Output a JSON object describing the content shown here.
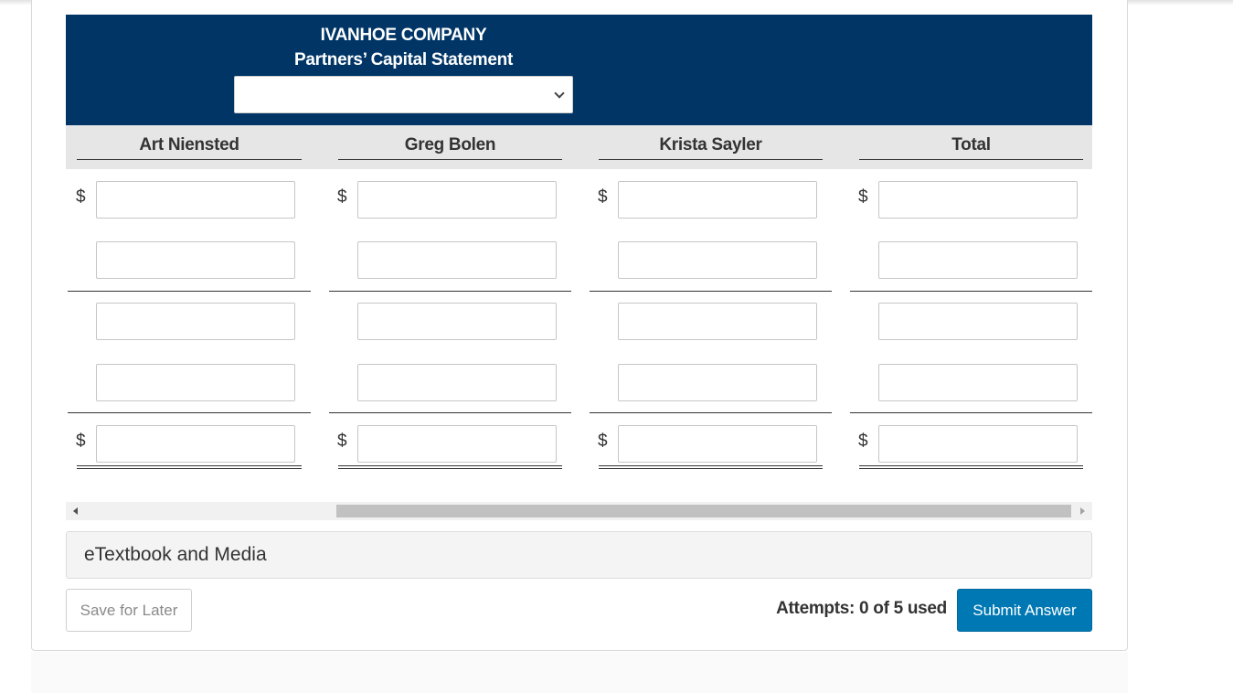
{
  "statement": {
    "company": "IVANHOE COMPANY",
    "title": "Partners’ Capital Statement",
    "date_select_value": ""
  },
  "columns": [
    "Art Niensted",
    "Greg Bolen",
    "Krista Sayler",
    "Total"
  ],
  "currency_symbol": "$",
  "media": {
    "label": "eTextbook and Media"
  },
  "footer": {
    "save_label": "Save for Later",
    "attempts_text": "Attempts: 0 of 5 used",
    "submit_label": "Submit Answer"
  },
  "colors": {
    "header_bg": "#003566",
    "submit_bg": "#0078b4"
  }
}
